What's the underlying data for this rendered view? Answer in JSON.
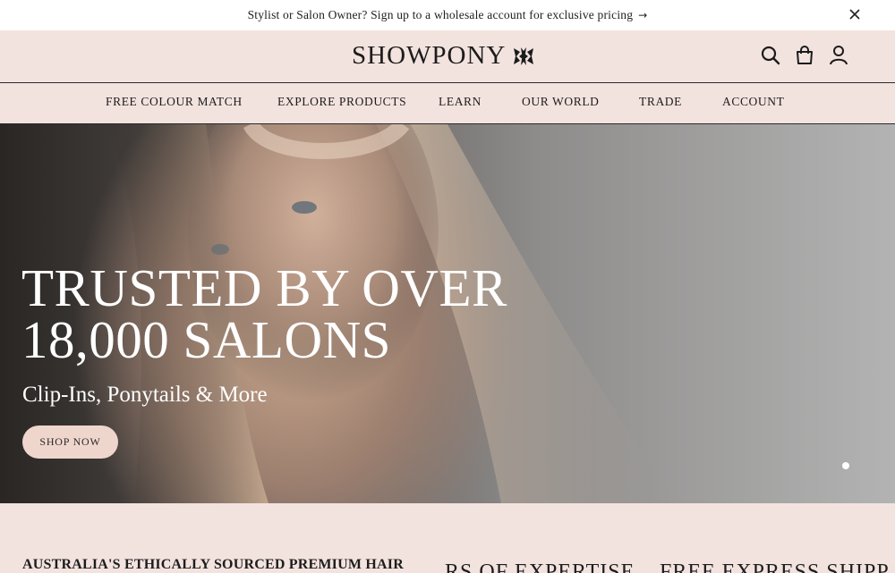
{
  "announcement": {
    "text": "Stylist or Salon Owner? Sign up to a wholesale account for exclusive pricing",
    "arrow": "→"
  },
  "header": {
    "logo_text": "SHOWPONY"
  },
  "nav": {
    "items": [
      "FREE COLOUR MATCH",
      "EXPLORE PRODUCTS",
      "LEARN",
      "OUR WORLD",
      "TRADE",
      "ACCOUNT"
    ]
  },
  "hero": {
    "title_line1": "TRUSTED BY OVER",
    "title_line2": "18,000 SALONS",
    "subtitle": "Clip-Ins, Ponytails & More",
    "button_label": "SHOP NOW"
  },
  "strip": {
    "left": "AUSTRALIA'S ETHICALLY SOURCED PREMIUM HAIR",
    "middle": "RS OF EXPERTISE",
    "right": "FREE EXPRESS SHIPP"
  },
  "colors": {
    "background": "#f3e3df",
    "button": "#efd6cc",
    "text": "#1d1d1d"
  }
}
